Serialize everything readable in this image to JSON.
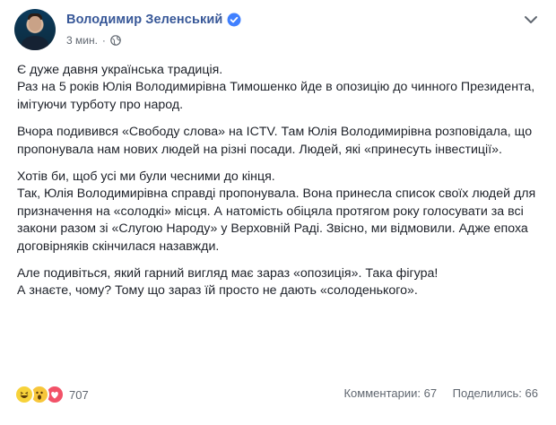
{
  "post": {
    "author": "Володимир Зеленський",
    "time": "3 мин.",
    "separator": "·",
    "paragraphs": [
      "Є дуже давня українська традиція.\nРаз на 5 років Юлія Володимирівна Тимошенко йде в опозицію до чинного Президента, імітуючи турботу про народ.",
      "Вчора подивився «Свободу слова» на ICTV. Там Юлія Володимирівна розповідала, що пропонувала нам нових людей на різні посади. Людей, які «принесуть інвестиції».",
      "Хотів би, щоб усі ми були чесними до кінця.\nТак, Юлія Володимирівна справді пропонувала. Вона принесла список своїх людей для призначення на «солодкі» місця. А натомість обіцяла протягом року голосувати за всі закони разом зі «Слугою Народу» у Верховній Раді. Звісно, ми відмовили. Адже епоха договірняків скінчилася назавжди.",
      "Але подивіться, який гарний вигляд має зараз «опозиція». Така фігура!\nА знаєте, чому? Тому що зараз їй просто не дають «солоденького»."
    ]
  },
  "footer": {
    "reaction_count": "707",
    "comments": "Комментарии: 67",
    "shares": "Поделились: 66"
  },
  "icons": {
    "verified": "verified-badge-icon",
    "privacy": "globe-icon",
    "menu": "chevron-down-icon",
    "reactions": [
      "haha-icon",
      "wow-icon",
      "love-icon"
    ]
  },
  "colors": {
    "author": "#385898",
    "meta": "#606770",
    "text": "#1d2129",
    "verified": "#4080ff",
    "love": "#f25268",
    "haha": "#f7d23a"
  }
}
